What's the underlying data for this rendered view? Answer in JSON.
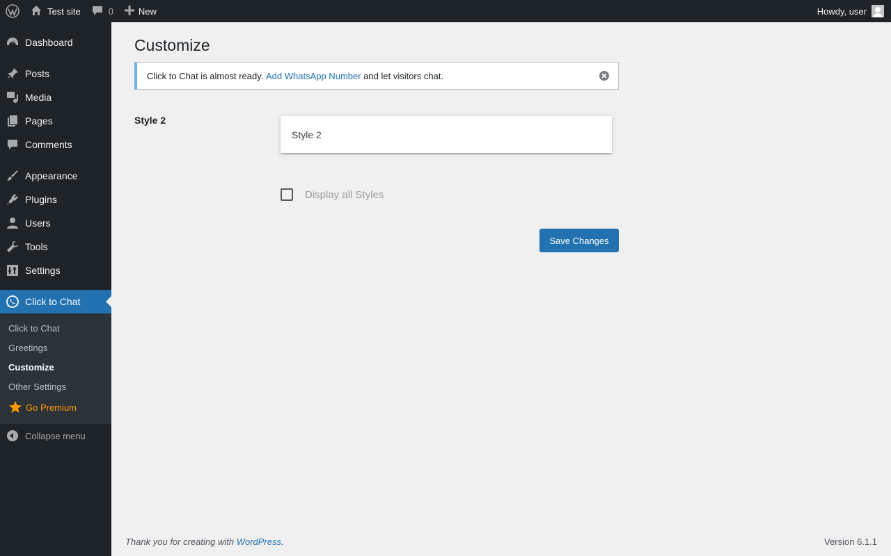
{
  "adminbar": {
    "site_name": "Test site",
    "comments_count": "0",
    "new_label": "New",
    "howdy": "Howdy, user"
  },
  "sidebar": {
    "items": [
      {
        "label": "Dashboard",
        "icon": "dashboard-icon"
      },
      {
        "label": "Posts",
        "icon": "pin-icon"
      },
      {
        "label": "Media",
        "icon": "media-icon"
      },
      {
        "label": "Pages",
        "icon": "pages-icon"
      },
      {
        "label": "Comments",
        "icon": "comment-icon"
      },
      {
        "label": "Appearance",
        "icon": "brush-icon"
      },
      {
        "label": "Plugins",
        "icon": "plug-icon"
      },
      {
        "label": "Users",
        "icon": "user-icon"
      },
      {
        "label": "Tools",
        "icon": "wrench-icon"
      },
      {
        "label": "Settings",
        "icon": "settings-icon"
      },
      {
        "label": "Click to Chat",
        "icon": "whatsapp-icon"
      }
    ],
    "submenu": [
      {
        "label": "Click to Chat"
      },
      {
        "label": "Greetings"
      },
      {
        "label": "Customize"
      },
      {
        "label": "Other Settings"
      },
      {
        "label": "Go Premium"
      }
    ],
    "collapse_label": "Collapse menu"
  },
  "main": {
    "title": "Customize",
    "notice": {
      "text_before": "Click to Chat is almost ready. ",
      "link": "Add WhatsApp Number",
      "text_after": " and let visitors chat."
    },
    "row_label": "Style 2",
    "select_value": "Style 2",
    "checkbox_label": "Display all Styles",
    "save_label": "Save Changes"
  },
  "footer": {
    "thanks_before": "Thank you for creating with ",
    "thanks_link": "WordPress",
    "thanks_after": ".",
    "version": "Version 6.1.1"
  },
  "colors": {
    "accent": "#2271b1",
    "sidebar_bg": "#1d2327",
    "submenu_bg": "#2c3338",
    "premium": "#ff9900",
    "notice_border": "#72aee6"
  }
}
